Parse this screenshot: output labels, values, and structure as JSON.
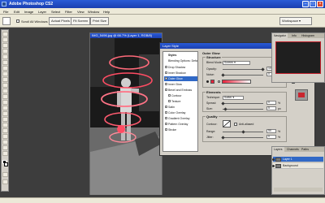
{
  "app": {
    "title": "Adobe Photoshop CS2"
  },
  "menu": [
    "File",
    "Edit",
    "Image",
    "Layer",
    "Select",
    "Filter",
    "View",
    "Window",
    "Help"
  ],
  "options_bar": {
    "scroll_all_windows": "Scroll All Windows",
    "actual_pixels": "Actual Pixels",
    "fit_screen": "Fit Screen",
    "print_size": "Print Size",
    "workspace": "Workspace"
  },
  "document": {
    "title": "IMG_5496.jpg @ 66.7% (Layer 1, RGB/8)"
  },
  "layer_style": {
    "title": "Layer Style",
    "styles_header": "Styles",
    "blending_options": "Blending Options: Default",
    "items": [
      "Drop Shadow",
      "Inner Shadow",
      "Outer Glow",
      "Inner Glow",
      "Bevel and Emboss",
      "Contour",
      "Texture",
      "Satin",
      "Color Overlay",
      "Gradient Overlay",
      "Pattern Overlay",
      "Stroke"
    ],
    "selected_index": 2,
    "section_title": "Outer Glow",
    "structure": {
      "title": "Structure",
      "blend_mode_label": "Blend Mode:",
      "blend_mode_value": "Screen",
      "opacity_label": "Opacity:",
      "opacity_value": "100",
      "noise_label": "Noise:",
      "noise_value": "0",
      "percent": "%",
      "glow_color": "#e8213a"
    },
    "elements": {
      "title": "Elements",
      "technique_label": "Technique:",
      "technique_value": "Softer",
      "spread_label": "Spread:",
      "spread_value": "0",
      "size_label": "Size:",
      "size_value": "5",
      "px": "px",
      "percent": "%"
    },
    "quality": {
      "title": "Quality",
      "contour_label": "Contour:",
      "anti_aliased_label": "Anti-aliased",
      "range_label": "Range:",
      "range_value": "50",
      "jitter_label": "Jitter:",
      "jitter_value": "0",
      "percent": "%"
    },
    "buttons": {
      "ok": "OK",
      "cancel": "Cancel",
      "new_style": "New Style...",
      "preview": "Preview"
    }
  },
  "panels": {
    "navigator_tabs": [
      "Navigator",
      "Info",
      "Histogram"
    ],
    "layers_tabs": [
      "Layers",
      "Channels",
      "Paths"
    ],
    "layers": [
      {
        "name": "Layer 1"
      },
      {
        "name": "Background"
      }
    ]
  }
}
